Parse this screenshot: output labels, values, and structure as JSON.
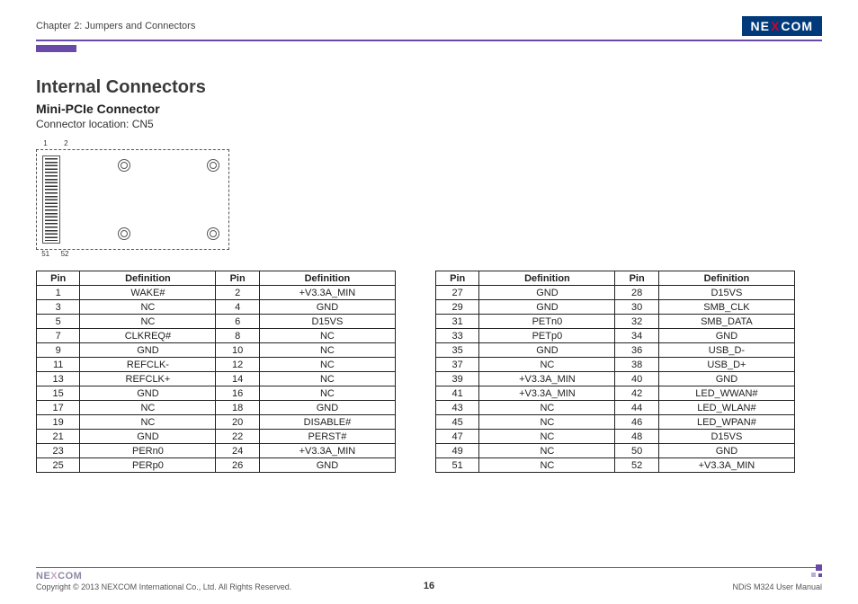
{
  "header": {
    "chapter": "Chapter 2: Jumpers and Connectors",
    "logo_pre": "NE",
    "logo_x": "X",
    "logo_post": "COM"
  },
  "titles": {
    "h1": "Internal Connectors",
    "h2": "Mini-PCIe Connector",
    "loc": "Connector location: CN5"
  },
  "diagram": {
    "p1": "1",
    "p2": "2",
    "p51": "51",
    "p52": "52"
  },
  "th": {
    "pin": "Pin",
    "def": "Definition"
  },
  "t1": [
    {
      "a": "1",
      "b": "WAKE#",
      "c": "2",
      "d": "+V3.3A_MIN"
    },
    {
      "a": "3",
      "b": "NC",
      "c": "4",
      "d": "GND"
    },
    {
      "a": "5",
      "b": "NC",
      "c": "6",
      "d": "D15VS"
    },
    {
      "a": "7",
      "b": "CLKREQ#",
      "c": "8",
      "d": "NC"
    },
    {
      "a": "9",
      "b": "GND",
      "c": "10",
      "d": "NC"
    },
    {
      "a": "11",
      "b": "REFCLK-",
      "c": "12",
      "d": "NC"
    },
    {
      "a": "13",
      "b": "REFCLK+",
      "c": "14",
      "d": "NC"
    },
    {
      "a": "15",
      "b": "GND",
      "c": "16",
      "d": "NC"
    },
    {
      "a": "17",
      "b": "NC",
      "c": "18",
      "d": "GND"
    },
    {
      "a": "19",
      "b": "NC",
      "c": "20",
      "d": "DISABLE#"
    },
    {
      "a": "21",
      "b": "GND",
      "c": "22",
      "d": "PERST#"
    },
    {
      "a": "23",
      "b": "PERn0",
      "c": "24",
      "d": "+V3.3A_MIN"
    },
    {
      "a": "25",
      "b": "PERp0",
      "c": "26",
      "d": "GND"
    }
  ],
  "t2": [
    {
      "a": "27",
      "b": "GND",
      "c": "28",
      "d": "D15VS"
    },
    {
      "a": "29",
      "b": "GND",
      "c": "30",
      "d": "SMB_CLK"
    },
    {
      "a": "31",
      "b": "PETn0",
      "c": "32",
      "d": "SMB_DATA"
    },
    {
      "a": "33",
      "b": "PETp0",
      "c": "34",
      "d": "GND"
    },
    {
      "a": "35",
      "b": "GND",
      "c": "36",
      "d": "USB_D-"
    },
    {
      "a": "37",
      "b": "NC",
      "c": "38",
      "d": "USB_D+"
    },
    {
      "a": "39",
      "b": "+V3.3A_MIN",
      "c": "40",
      "d": "GND"
    },
    {
      "a": "41",
      "b": "+V3.3A_MIN",
      "c": "42",
      "d": "LED_WWAN#"
    },
    {
      "a": "43",
      "b": "NC",
      "c": "44",
      "d": "LED_WLAN#"
    },
    {
      "a": "45",
      "b": "NC",
      "c": "46",
      "d": "LED_WPAN#"
    },
    {
      "a": "47",
      "b": "NC",
      "c": "48",
      "d": "D15VS"
    },
    {
      "a": "49",
      "b": "NC",
      "c": "50",
      "d": "GND"
    },
    {
      "a": "51",
      "b": "NC",
      "c": "52",
      "d": "+V3.3A_MIN"
    }
  ],
  "footer": {
    "logo_pre": "NE",
    "logo_x": "X",
    "logo_post": "COM",
    "copyright": "Copyright © 2013 NEXCOM International Co., Ltd. All Rights Reserved.",
    "page": "16",
    "doc": "NDiS M324 User Manual"
  }
}
